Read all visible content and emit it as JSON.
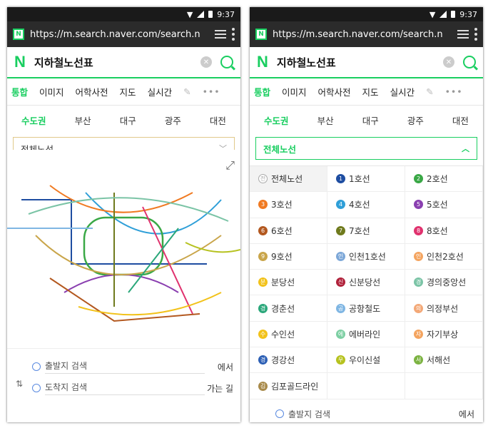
{
  "status": {
    "time": "9:37"
  },
  "browser": {
    "url": "https://m.search.naver.com/search.n",
    "favicon": "N"
  },
  "search": {
    "logo": "N",
    "query": "지하철노선표"
  },
  "nav_tabs": [
    "통합",
    "이미지",
    "어학사전",
    "지도",
    "실시간"
  ],
  "regions": [
    "수도권",
    "부산",
    "대구",
    "광주",
    "대전"
  ],
  "line_select": {
    "label": "전체노선"
  },
  "route": {
    "origin": "출발지 검색",
    "origin_suffix": "에서",
    "destination": "도착지 검색",
    "destination_suffix": "가는 길"
  },
  "lines": [
    {
      "label": "전체노선",
      "badge": "전",
      "color": "#aaaaaa"
    },
    {
      "label": "1호선",
      "badge": "1",
      "color": "#1e4da1"
    },
    {
      "label": "2호선",
      "badge": "2",
      "color": "#3aa846"
    },
    {
      "label": "3호선",
      "badge": "3",
      "color": "#f07a22"
    },
    {
      "label": "4호선",
      "badge": "4",
      "color": "#2f9fd8"
    },
    {
      "label": "5호선",
      "badge": "5",
      "color": "#8a3fb0"
    },
    {
      "label": "6호선",
      "badge": "6",
      "color": "#b3581f"
    },
    {
      "label": "7호선",
      "badge": "7",
      "color": "#6f7a1d"
    },
    {
      "label": "8호선",
      "badge": "8",
      "color": "#e0326e"
    },
    {
      "label": "9호선",
      "badge": "9",
      "color": "#c9a54a"
    },
    {
      "label": "인천1호선",
      "badge": "인",
      "color": "#7ca7d8"
    },
    {
      "label": "인천2호선",
      "badge": "인",
      "color": "#f4a45f"
    },
    {
      "label": "분당선",
      "badge": "분",
      "color": "#f2c21a"
    },
    {
      "label": "신분당선",
      "badge": "신",
      "color": "#b0213a"
    },
    {
      "label": "경의중앙선",
      "badge": "경",
      "color": "#7bc4a6"
    },
    {
      "label": "경춘선",
      "badge": "경",
      "color": "#2aa77a"
    },
    {
      "label": "공항철도",
      "badge": "공",
      "color": "#7fb6e3"
    },
    {
      "label": "의정부선",
      "badge": "의",
      "color": "#f3a877"
    },
    {
      "label": "수인선",
      "badge": "수",
      "color": "#f2c21a"
    },
    {
      "label": "에버라인",
      "badge": "에",
      "color": "#7dcfa3"
    },
    {
      "label": "자기부상",
      "badge": "자",
      "color": "#f4a45f"
    },
    {
      "label": "경강선",
      "badge": "경",
      "color": "#2c5fb5"
    },
    {
      "label": "우이신설",
      "badge": "우",
      "color": "#b6c21f"
    },
    {
      "label": "서해선",
      "badge": "서",
      "color": "#7cb342"
    },
    {
      "label": "김포골드라인",
      "badge": "김",
      "color": "#a88a4a"
    }
  ]
}
